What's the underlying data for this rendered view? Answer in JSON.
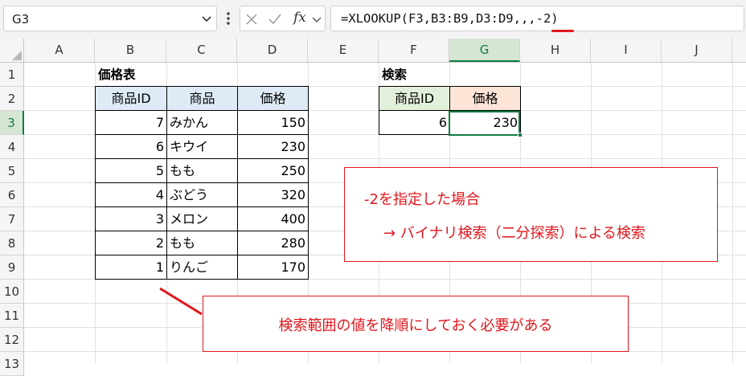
{
  "formula_bar": {
    "name_box": "G3",
    "fx_label": "fx",
    "formula_text": "=XLOOKUP(F3,B3:B9,D3:D9,,,-2)"
  },
  "columns": [
    "A",
    "B",
    "C",
    "D",
    "E",
    "F",
    "G",
    "H",
    "I",
    "J"
  ],
  "rows": [
    "1",
    "2",
    "3",
    "4",
    "5",
    "6",
    "7",
    "8",
    "9",
    "10",
    "11",
    "12",
    "13"
  ],
  "price_table": {
    "title": "価格表",
    "headers": [
      "商品ID",
      "商品",
      "価格"
    ],
    "rows": [
      {
        "id": "7",
        "name": "みかん",
        "price": "150"
      },
      {
        "id": "6",
        "name": "キウイ",
        "price": "230"
      },
      {
        "id": "5",
        "name": "もも",
        "price": "250"
      },
      {
        "id": "4",
        "name": "ぶどう",
        "price": "320"
      },
      {
        "id": "3",
        "name": "メロン",
        "price": "400"
      },
      {
        "id": "2",
        "name": "もも",
        "price": "280"
      },
      {
        "id": "1",
        "name": "りんご",
        "price": "170"
      }
    ]
  },
  "search_table": {
    "title": "検索",
    "headers": [
      "商品ID",
      "価格"
    ],
    "id_value": "6",
    "price_value": "230"
  },
  "callouts": {
    "binary_line1": "-2を指定した場合",
    "binary_line2": "→ バイナリ検索（二分探索）による検索",
    "descending_note": "検索範囲の値を降順にしておく必要がある"
  },
  "colors": {
    "accent_red": "#e0161c",
    "select_green": "#107c41",
    "header_blue": "#deebf7",
    "header_green": "#e2efda",
    "header_peach": "#fce4d6"
  }
}
